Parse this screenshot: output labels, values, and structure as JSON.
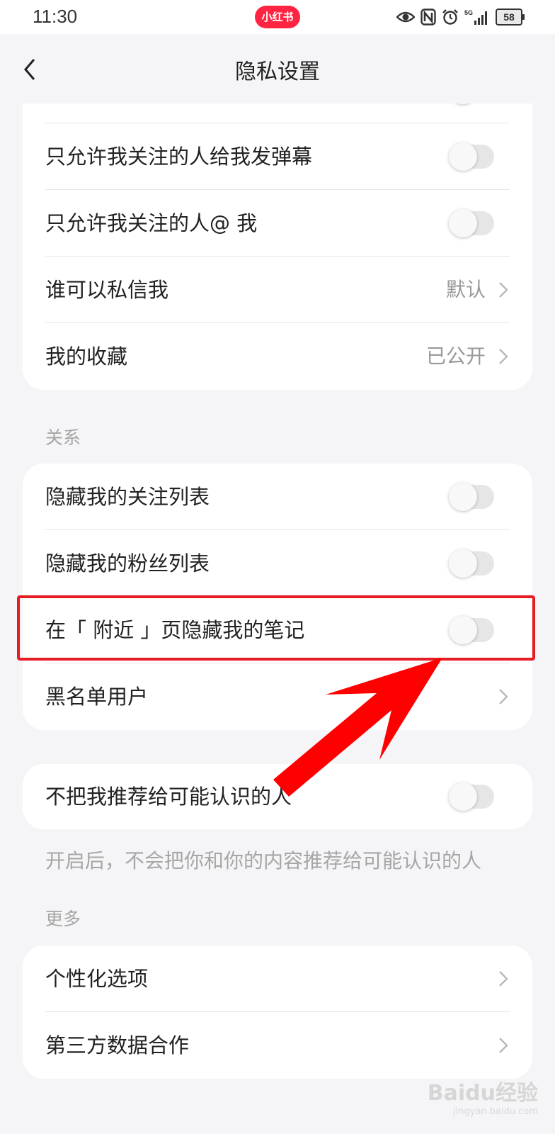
{
  "status_bar": {
    "time": "11:30",
    "app_badge": "小红书",
    "network": "5G",
    "battery": "58",
    "icons": [
      "eye-icon",
      "nfc-icon",
      "alarm-icon",
      "signal-icon",
      "battery-icon"
    ]
  },
  "header": {
    "title": "隐私设置",
    "back_icon": "chevron-left-icon"
  },
  "card_top": {
    "rows": [
      {
        "label": "只允许我关注的人给我发弹幕",
        "toggle": false
      },
      {
        "label": "只允许我关注的人@ 我",
        "toggle": false
      },
      {
        "label": "谁可以私信我",
        "value": "默认"
      },
      {
        "label": "我的收藏",
        "value": "已公开"
      }
    ]
  },
  "section_relation": {
    "header": "关系",
    "rows": [
      {
        "label": "隐藏我的关注列表",
        "toggle": false
      },
      {
        "label": "隐藏我的粉丝列表",
        "toggle": false
      },
      {
        "label": "在「 附近 」页隐藏我的笔记",
        "toggle": false
      },
      {
        "label": "黑名单用户"
      }
    ]
  },
  "recommend": {
    "label": "不把我推荐给可能认识的人",
    "toggle": false,
    "note": "开启后，不会把你和你的内容推荐给可能认识的人"
  },
  "section_more": {
    "header": "更多",
    "rows": [
      {
        "label": "个性化选项"
      },
      {
        "label": "第三方数据合作"
      }
    ]
  },
  "annotation": {
    "highlight_color": "#e61c24",
    "arrow_color": "#ff0000"
  },
  "watermark": {
    "line1": "Baidu经验",
    "line2": "jingyan.baidu.com"
  },
  "colors": {
    "brand": "#ff2442",
    "background": "#f5f5f7",
    "card": "#ffffff",
    "toggle_off": "#e6e6e6",
    "secondary_text": "#999999"
  }
}
